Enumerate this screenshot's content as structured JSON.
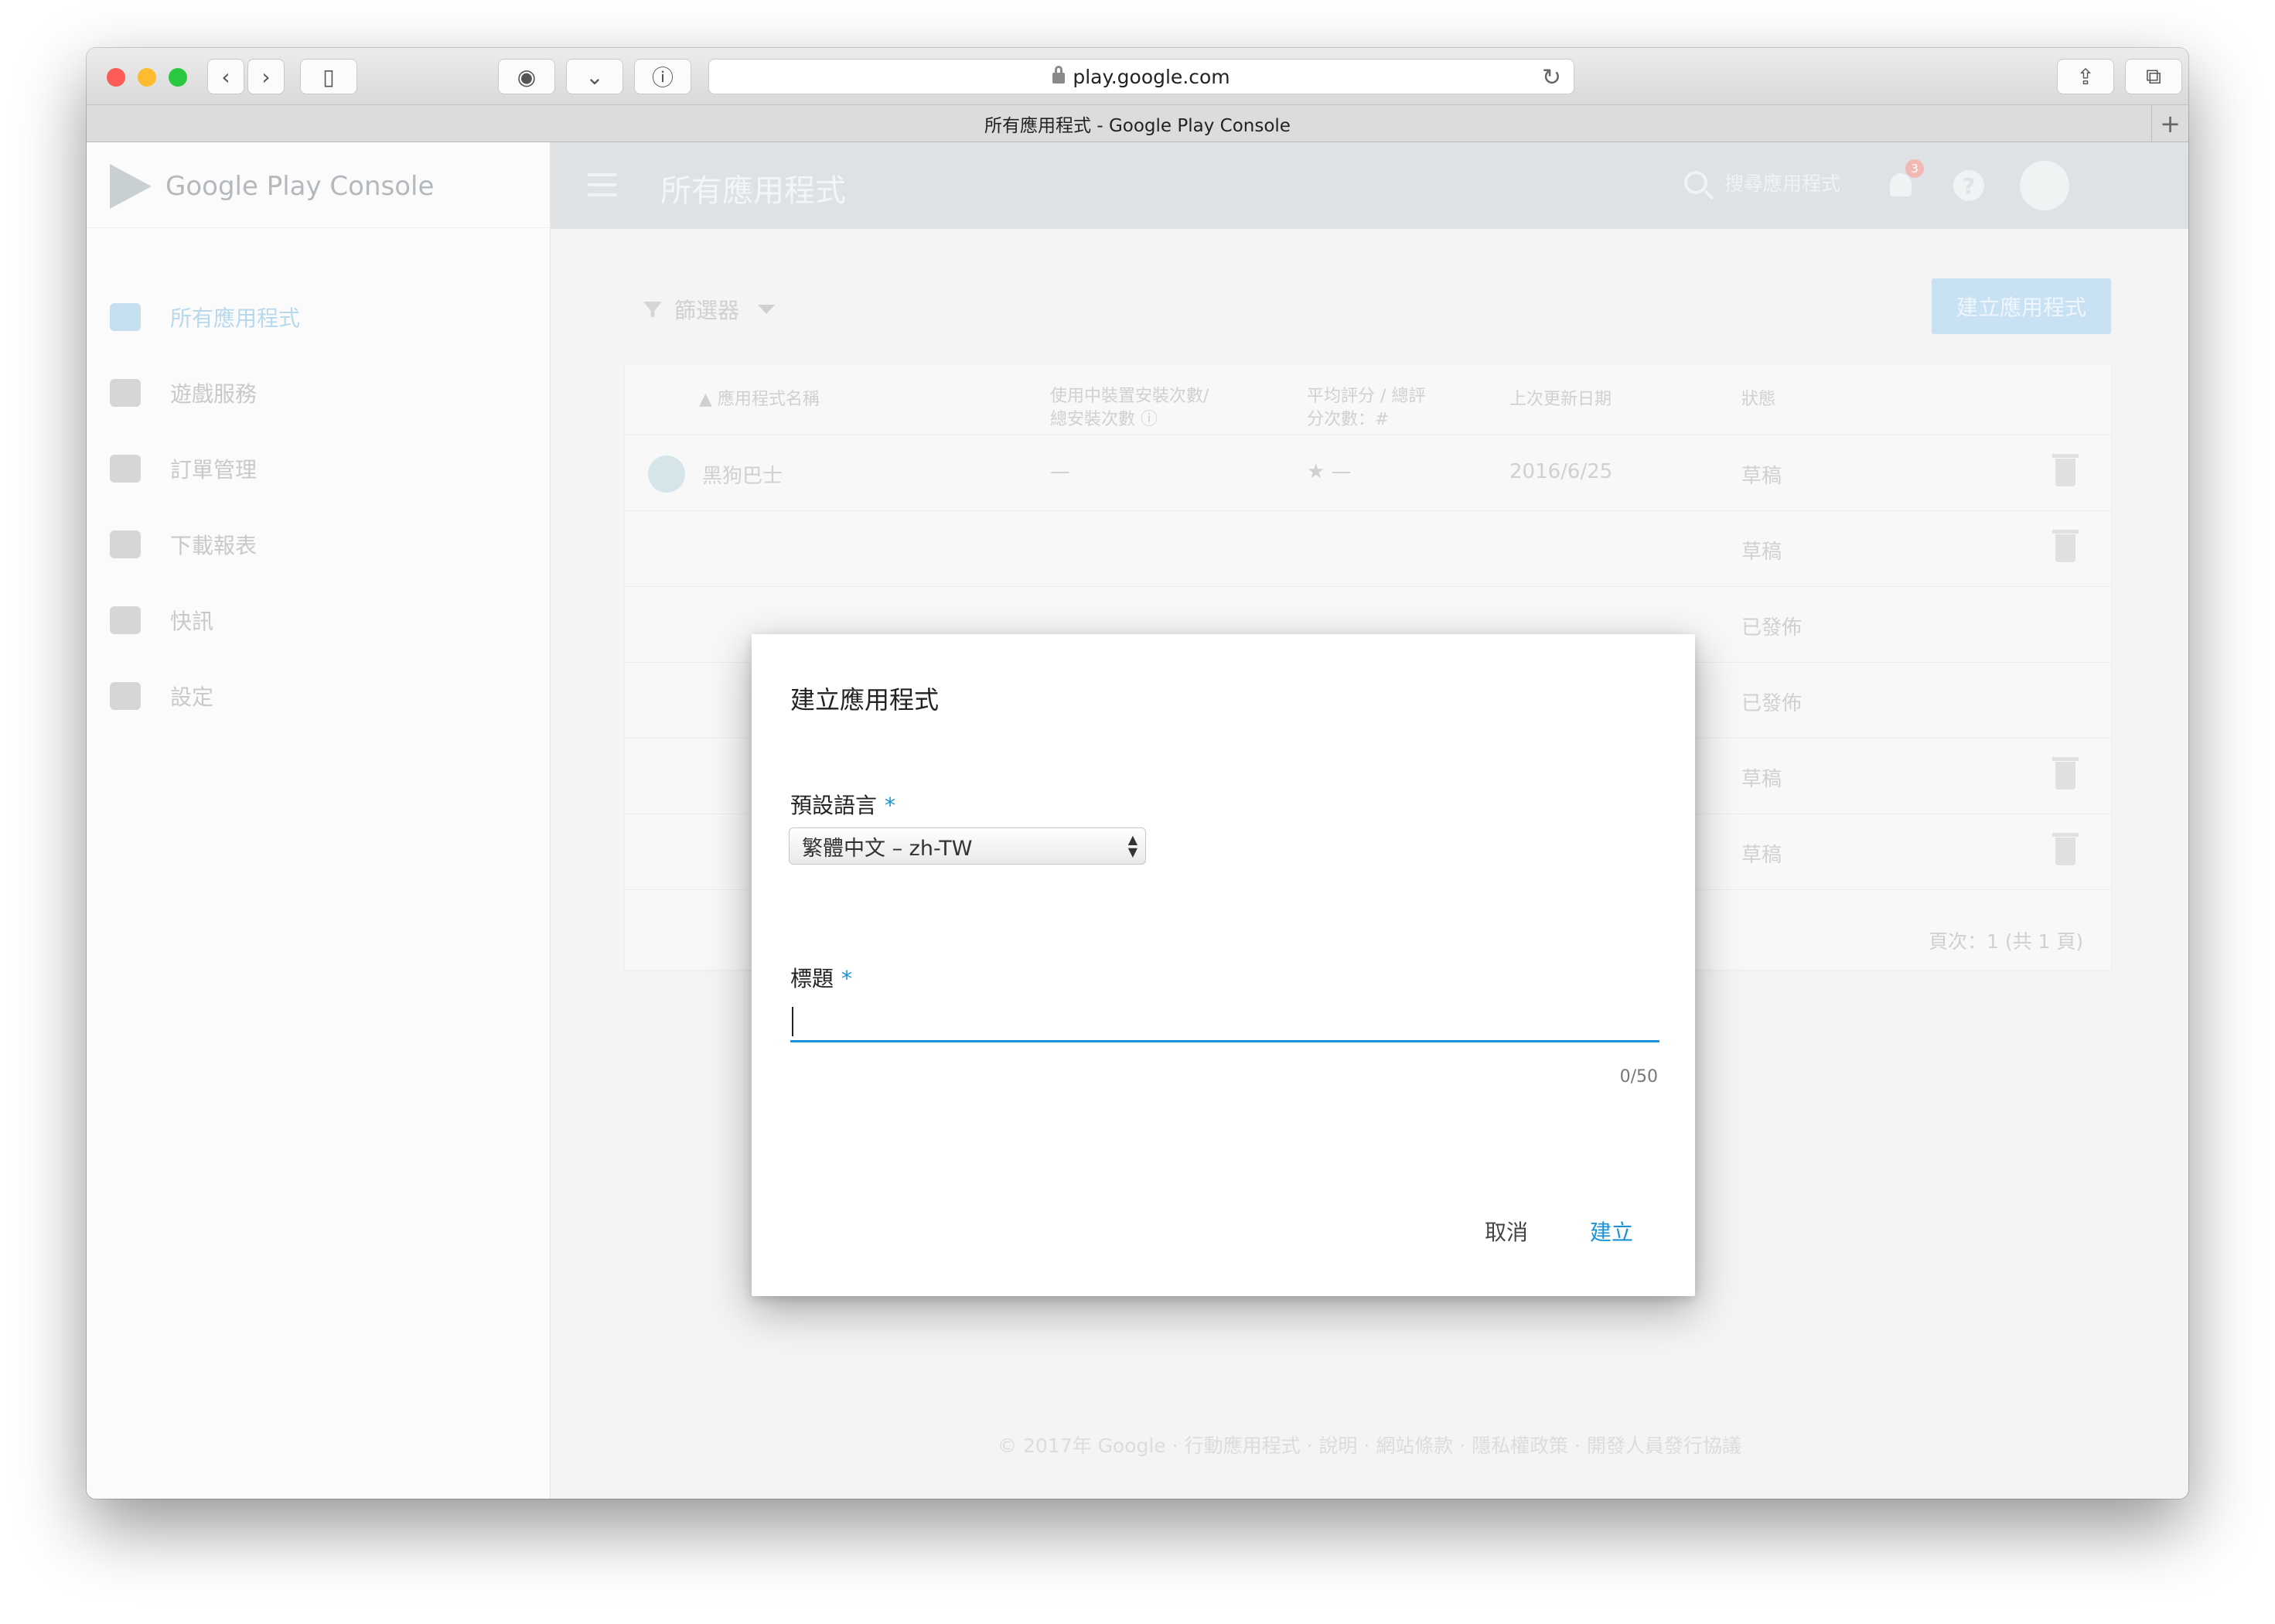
{
  "browser": {
    "url": "play.google.com",
    "tab_title": "所有應用程式 - Google Play Console"
  },
  "sidebar": {
    "brand": "Google Play Console",
    "items": [
      {
        "label": "所有應用程式",
        "icon": "android-icon",
        "active": true
      },
      {
        "label": "遊戲服務",
        "icon": "gamepad-icon"
      },
      {
        "label": "訂單管理",
        "icon": "credit-card-icon"
      },
      {
        "label": "下載報表",
        "icon": "download-box-icon"
      },
      {
        "label": "快訊",
        "icon": "warning-icon"
      },
      {
        "label": "設定",
        "icon": "gear-icon"
      }
    ]
  },
  "appbar": {
    "title": "所有應用程式",
    "search_placeholder": "搜尋應用程式",
    "notification_count": "3"
  },
  "toolbar": {
    "filter_label": "篩選器",
    "create_label": "建立應用程式"
  },
  "table": {
    "headers": {
      "name": "應用程式名稱",
      "installs_line1": "使用中裝置安裝次數/",
      "installs_line2": "總安裝次數",
      "rating_line1": "平均評分 / 總評",
      "rating_line2": "分次數：#",
      "updated": "上次更新日期",
      "status": "狀態"
    },
    "rows": [
      {
        "name": "黑狗巴士",
        "installs": "—",
        "rating": "—",
        "updated": "2016/6/25",
        "status": "草稿"
      },
      {
        "status": "草稿"
      },
      {
        "status": "已發佈"
      },
      {
        "status": "已發佈"
      },
      {
        "status": "草稿"
      },
      {
        "status": "草稿"
      }
    ],
    "pager": "頁次：1 (共 1 頁)"
  },
  "footer": "© 2017年 Google · 行動應用程式 · 說明 · 網站條款 · 隱私權政策 · 開發人員發行協議",
  "dialog": {
    "title": "建立應用程式",
    "language_label": "預設語言",
    "language_value": "繁體中文 – zh-TW",
    "title_label": "標題",
    "required_mark": "*",
    "title_value": "",
    "counter": "0/50",
    "cancel": "取消",
    "create": "建立"
  },
  "colors": {
    "accent": "#1a93d6",
    "appbar": "#dee2e4"
  }
}
